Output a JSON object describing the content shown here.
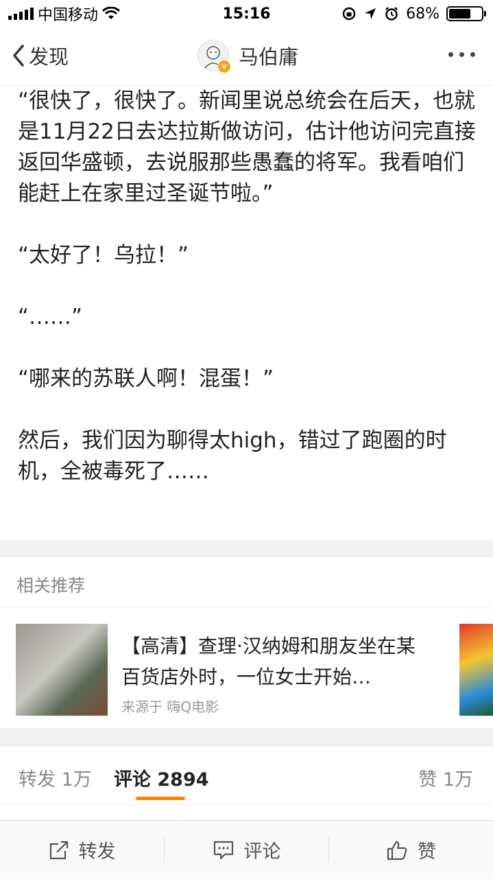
{
  "status_bar": {
    "carrier": "中国移动",
    "time": "15:16",
    "battery_percent": "68%",
    "battery_level": 0.68
  },
  "nav": {
    "back_label": "发现",
    "author_name": "马伯庸",
    "verified_badge": "v"
  },
  "article": {
    "paragraphs": [
      "“很快了，很快了。新闻里说总统会在后天，也就是11月22日去达拉斯做访问，估计他访问完直接返回华盛顿，去说服那些愚蠢的将军。我看咱们能赶上在家里过圣诞节啦。”",
      "“太好了！乌拉！”",
      "“……”",
      "“哪来的苏联人啊！混蛋！”",
      "然后，我们因为聊得太high，错过了跑圈的时机，全被毒死了……"
    ]
  },
  "related": {
    "section_title": "相关推荐",
    "item": {
      "title": "【高清】查理·汉纳姆和朋友坐在某百货店外时，一位女士开始…",
      "source": "来源于 嗨Q电影"
    }
  },
  "tabs": {
    "repost": "转发 1万",
    "comments": "评论 2894",
    "likes": "赞 1万"
  },
  "bottom_bar": {
    "repost": "转发",
    "comment": "评论",
    "like": "赞"
  },
  "colors": {
    "accent": "#ff8200",
    "badge": "#f5a623",
    "divider": "#f1f1f1"
  }
}
